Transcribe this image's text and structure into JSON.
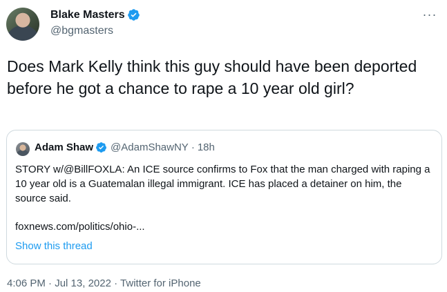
{
  "author": {
    "display_name": "Blake Masters",
    "handle": "@bgmasters"
  },
  "tweet": {
    "text": "Does Mark Kelly think this guy should have been deported before he got a chance to rape a 10 year old girl?"
  },
  "quoted": {
    "display_name": "Adam Shaw",
    "handle": "@AdamShawNY",
    "separator": "·",
    "time": "18h",
    "text": "STORY w/@BillFOXLA: An ICE source confirms to Fox that the man charged with raping a 10 year old is a Guatemalan illegal immigrant. ICE has placed a detainer on him, the source said.",
    "link": "foxnews.com/politics/ohio-...",
    "show_thread": "Show this thread"
  },
  "meta": {
    "time": "4:06 PM",
    "dot1": "·",
    "date": "Jul 13, 2022",
    "dot2": "·",
    "source": "Twitter for iPhone"
  },
  "icons": {
    "verified": "verified-badge-icon",
    "more": "more-options-icon"
  },
  "colors": {
    "verified_blue": "#1d9bf0",
    "link_blue": "#1d9bf0",
    "secondary_text": "#536471",
    "border": "#cfd9de"
  }
}
